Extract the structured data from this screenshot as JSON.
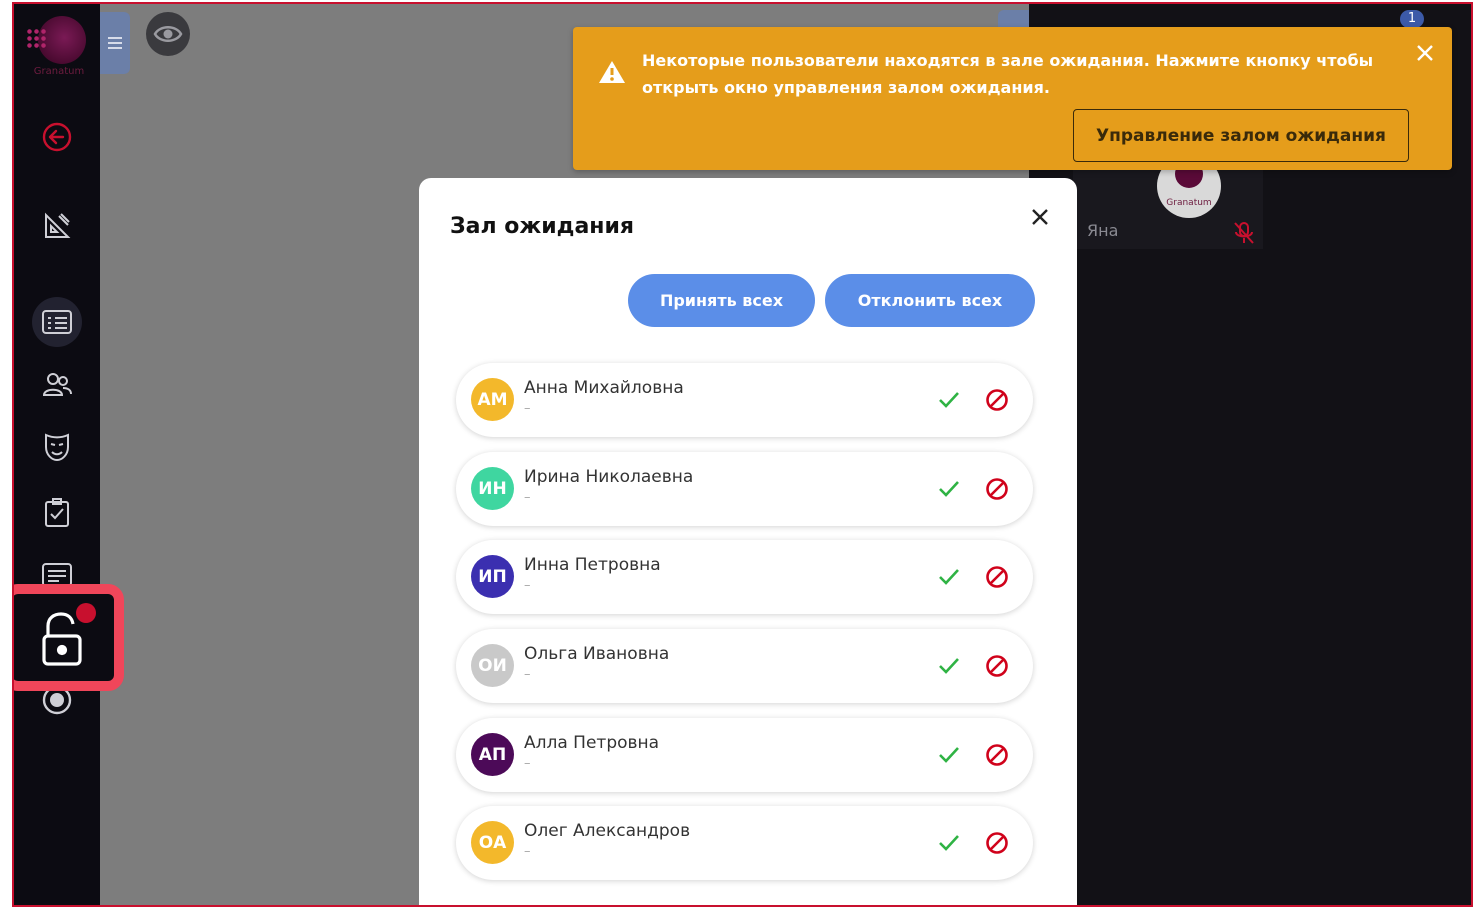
{
  "brand": {
    "name": "Granatum"
  },
  "sidebar": {
    "icons": [
      "back-arrow-icon",
      "pen-ruler-icon",
      "presentation-list-icon",
      "users-icon",
      "mask-icon",
      "checklist-icon",
      "text-board-icon",
      "unlock-icon",
      "record-icon"
    ],
    "waiting_room_badge": true
  },
  "video": {
    "participant_name": "Яна",
    "avatar_brand": "Granatum",
    "count_badge": "1"
  },
  "toast": {
    "message": "Некоторые пользователи находятся в зале ожидания. Нажмите кнопку чтобы открыть окно управления залом ожидания.",
    "button_label": "Управление залом ожидания",
    "color": "#e59d1b"
  },
  "modal": {
    "title": "Зал ожидания",
    "accept_all_label": "Принять всех",
    "reject_all_label": "Отклонить всех",
    "users": [
      {
        "initials": "АМ",
        "name": "Анна Михайловна",
        "sub": "–",
        "color": "#f3b82b"
      },
      {
        "initials": "ИН",
        "name": "Ирина Николаевна",
        "sub": "–",
        "color": "#3fd6a0"
      },
      {
        "initials": "ИП",
        "name": "Инна Петровна",
        "sub": "–",
        "color": "#3b2fb0"
      },
      {
        "initials": "ОИ",
        "name": "Ольга Ивановна",
        "sub": "–",
        "color": "#c9c9c9"
      },
      {
        "initials": "АП",
        "name": "Алла Петровна",
        "sub": "–",
        "color": "#4c0a58"
      },
      {
        "initials": "ОА",
        "name": "Олег Александров",
        "sub": "–",
        "color": "#f3b82b"
      }
    ]
  },
  "colors": {
    "accept": "#2fb344",
    "reject": "#d0021b",
    "primary": "#5b8ee8"
  }
}
